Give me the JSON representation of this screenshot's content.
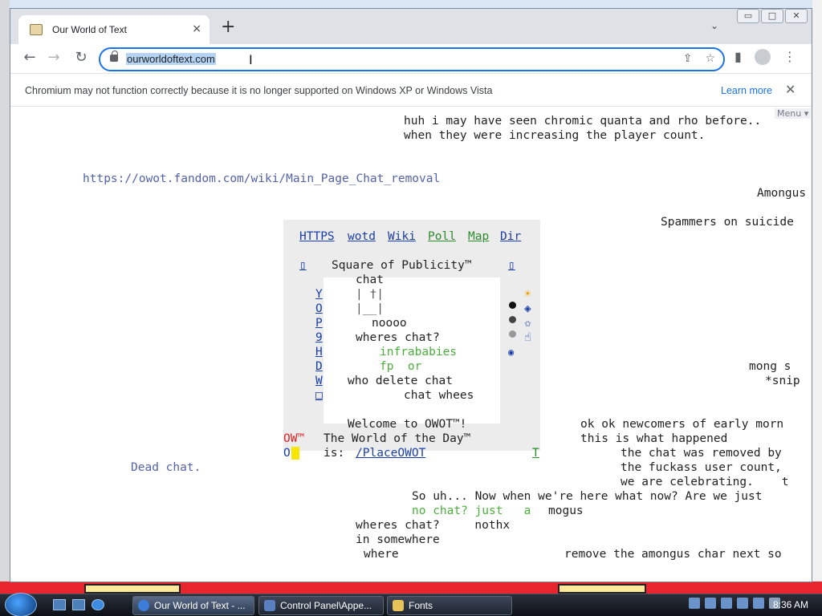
{
  "browser": {
    "tab_title": "Our World of Text",
    "tab_close": "×",
    "new_tab": "+",
    "tab_list": "⌄",
    "window_buttons": [
      "▭",
      "□",
      "✕"
    ],
    "url": "ourworldoftext.com",
    "back": "←",
    "forward": "→",
    "reload": "↻",
    "share_icon": "⇪",
    "star_icon": "☆",
    "sidepanel_icon": "▮",
    "menu_icon": "⋮"
  },
  "infobar": {
    "message": "Chromium may not function correctly because it is no longer supported on Windows XP or Windows Vista",
    "learn_more": "Learn more",
    "close": "✕"
  },
  "page": {
    "menu_label": "Menu ▾",
    "lines": {
      "l1": "huh i may have seen chromic quanta and rho before..",
      "l2": "when they were increasing the player count.",
      "link_fandom": "https://owot.fandom.com/wiki/Main_Page_Chat_removal",
      "amongus": "Amongus",
      "spammers": "Spammers on suicide",
      "mong": "mong s",
      "snip": "*snip",
      "ok_ok": "ok ok newcomers of early morn",
      "this_is": "this is what happened",
      "chat_removed": "the chat was removed by",
      "fuckass": "the fuckass user count,",
      "celebrating": "we are celebrating.    t",
      "dead_chat": "Dead chat.",
      "so_uh": "So uh... Now when we're here what now? Are we just",
      "no_chat": "no chat? just   a",
      "mogus": "mogus",
      "wheres_chat2": "wheres chat?     nothx",
      "in_somewhere": "in somewhere",
      "where": "where",
      "remove_amongus": "remove the amongus char next so"
    },
    "panel": {
      "links": [
        "HTTPS",
        "wotd",
        "Wiki",
        "Poll",
        "Map",
        "Dir"
      ],
      "square_title": "Square of Publicity™",
      "box_char": "▯",
      "left_letters": [
        "Y",
        "O",
        "P",
        "9",
        "H",
        "D",
        "W",
        "□"
      ],
      "chat": "chat",
      "art1": "| †|",
      "art2": "|__|",
      "noooo": "noooo",
      "wheres_chat": "wheres chat?",
      "infrababies": "infrababies",
      "fp_or": "fp  or",
      "who_delete": "who delete chat",
      "chat_whees": "chat whees",
      "welcome": "Welcome to OWOT™!",
      "ow": "OW™",
      "wotd": "The World of the Day™",
      "o_char": "O",
      "is_label": "is:",
      "place_link": "/PlaceOWOT",
      "t_link": "T",
      "right_icons": [
        "☀",
        "◈",
        "✩",
        "☝"
      ]
    }
  },
  "taskbar": {
    "tasks": [
      "Our World of Text - ...",
      "Control Panel\\Appe...",
      "Fonts"
    ],
    "clock": "8:36 AM"
  },
  "colors": {
    "accent": "#1a73e8",
    "page_blue": "#5263a8",
    "page_green": "#4caf3c",
    "taskbar": "#1a1f2a"
  }
}
